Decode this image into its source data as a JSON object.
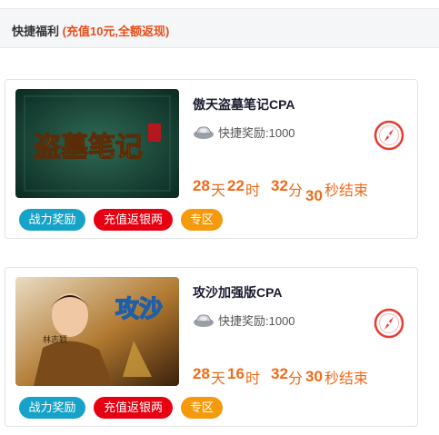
{
  "header": {
    "title": "快捷福利",
    "promo": "(充值10元,全额返现)"
  },
  "cards": [
    {
      "title": "傲天盗墓笔记CPA",
      "thumb_text": "盗墓笔记",
      "reward_label": "快捷奖励:1000",
      "countdown": {
        "days": "28",
        "days_unit": "天",
        "hours": "22",
        "hours_unit": "时",
        "minutes": "32",
        "minutes_unit": "分",
        "seconds": "30",
        "seconds_unit": "秒结束"
      },
      "tags": [
        "战力奖励",
        "充值返银两",
        "专区"
      ],
      "icon": "compass-icon"
    },
    {
      "title": "攻沙加强版CPA",
      "thumb_text": "攻沙",
      "thumb_caption": "林志颖",
      "reward_label": "快捷奖励:1000",
      "countdown": {
        "days": "28",
        "days_unit": "天",
        "hours": "16",
        "hours_unit": "时",
        "minutes": "32",
        "minutes_unit": "分",
        "seconds": "30",
        "seconds_unit": "秒结束"
      },
      "tags": [
        "战力奖励",
        "充值返银两",
        "专区"
      ],
      "icon": "compass-icon"
    }
  ],
  "colors": {
    "accent_orange": "#ef6a1a",
    "promo_red": "#e84e1b",
    "tag_blue": "#16a3c7",
    "tag_red": "#e60012",
    "tag_orange": "#f59a0c"
  }
}
